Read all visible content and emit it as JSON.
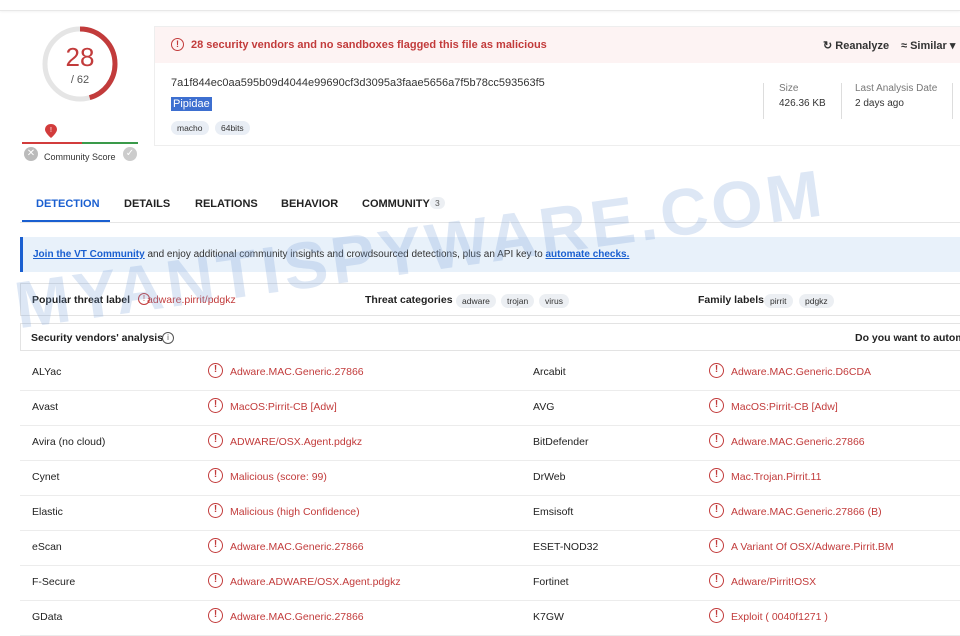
{
  "score": {
    "detections": "28",
    "total": "/ 62",
    "community_label": "Community Score"
  },
  "alert": {
    "text": "28 security vendors and no sandboxes flagged this file as malicious",
    "reanalyze": "Reanalyze",
    "similar": "Similar"
  },
  "file": {
    "hash": "7a1f844ec0aa595b09d4044e99690cf3d3095a3faae5656a7f5b78cc593563f5",
    "name": "Pipidae",
    "tags": [
      "macho",
      "64bits"
    ]
  },
  "meta": {
    "size_label": "Size",
    "size_value": "426.36 KB",
    "date_label": "Last Analysis Date",
    "date_value": "2 days ago"
  },
  "tabs": [
    {
      "label": "DETECTION"
    },
    {
      "label": "DETAILS"
    },
    {
      "label": "RELATIONS"
    },
    {
      "label": "BEHAVIOR"
    },
    {
      "label": "COMMUNITY"
    }
  ],
  "community_count": "3",
  "banner": {
    "link1": "Join the VT Community",
    "mid": " and enjoy additional community insights and crowdsourced detections, plus an API key to ",
    "link2": "automate checks."
  },
  "threat": {
    "popular_label": "Popular threat label",
    "popular_value": "adware.pirrit/pdgkz",
    "categories_label": "Threat categories",
    "categories": [
      "adware",
      "trojan",
      "virus"
    ],
    "family_label": "Family labels",
    "families": [
      "pirrit",
      "pdgkz"
    ]
  },
  "vendors_header": {
    "title": "Security vendors' analysis",
    "right": "Do you want to automa"
  },
  "vendors": [
    {
      "left_name": "ALYac",
      "left_result": "Adware.MAC.Generic.27866",
      "right_name": "Arcabit",
      "right_result": "Adware.MAC.Generic.D6CDA"
    },
    {
      "left_name": "Avast",
      "left_result": "MacOS:Pirrit-CB [Adw]",
      "right_name": "AVG",
      "right_result": "MacOS:Pirrit-CB [Adw]"
    },
    {
      "left_name": "Avira (no cloud)",
      "left_result": "ADWARE/OSX.Agent.pdgkz",
      "right_name": "BitDefender",
      "right_result": "Adware.MAC.Generic.27866"
    },
    {
      "left_name": "Cynet",
      "left_result": "Malicious (score: 99)",
      "right_name": "DrWeb",
      "right_result": "Mac.Trojan.Pirrit.11"
    },
    {
      "left_name": "Elastic",
      "left_result": "Malicious (high Confidence)",
      "right_name": "Emsisoft",
      "right_result": "Adware.MAC.Generic.27866 (B)"
    },
    {
      "left_name": "eScan",
      "left_result": "Adware.MAC.Generic.27866",
      "right_name": "ESET-NOD32",
      "right_result": "A Variant Of OSX/Adware.Pirrit.BM"
    },
    {
      "left_name": "F-Secure",
      "left_result": "Adware.ADWARE/OSX.Agent.pdgkz",
      "right_name": "Fortinet",
      "right_result": "Adware/Pirrit!OSX"
    },
    {
      "left_name": "GData",
      "left_result": "Adware.MAC.Generic.27866",
      "right_name": "K7GW",
      "right_result": "Exploit ( 0040f1271 )"
    }
  ],
  "watermark": "MYANTISPYWARE.COM",
  "colors": {
    "malicious": "#c23b3b",
    "accent": "#1a5fd0"
  }
}
